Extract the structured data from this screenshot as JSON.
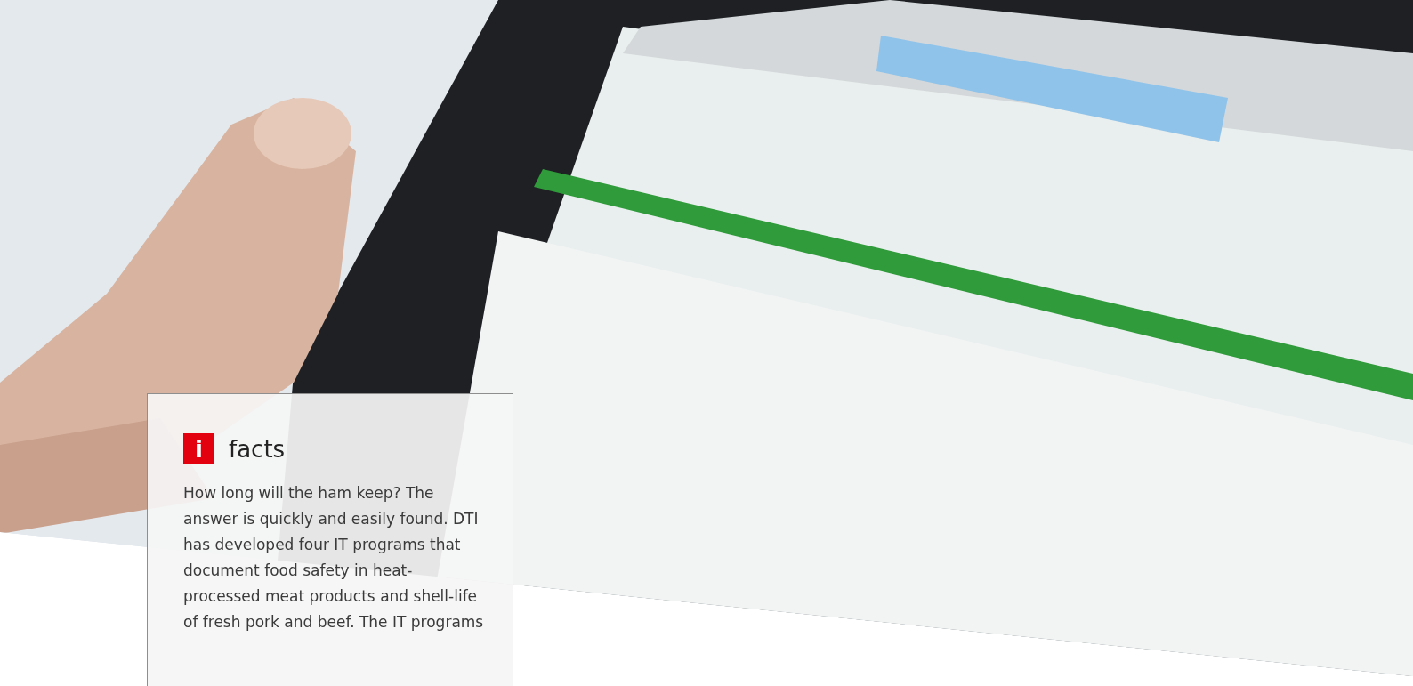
{
  "facts": {
    "icon": "i",
    "title": "facts",
    "text": "How long will the ham keep? The answer is quickly and easily found. DTI has developed four IT programs that document food safety in heat-processed meat products and shell-life of fresh pork and beef. The IT programs"
  }
}
